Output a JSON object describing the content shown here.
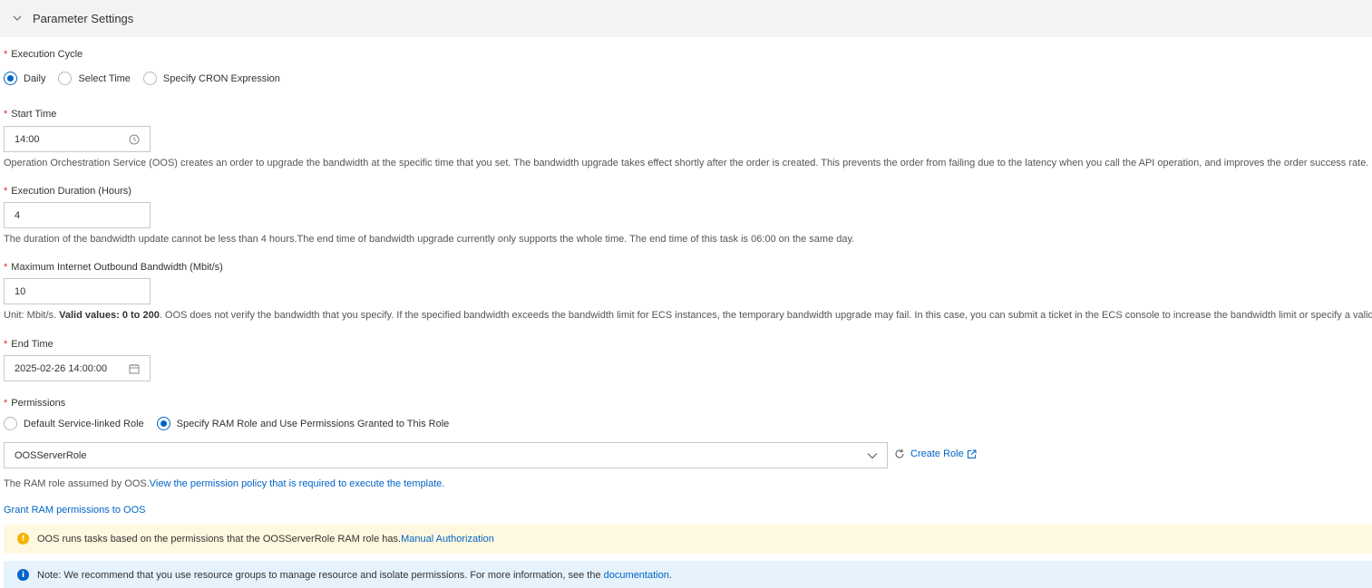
{
  "section": {
    "title": "Parameter Settings",
    "icon": "chevron-down-icon"
  },
  "required_mark": "*",
  "execution_cycle": {
    "label": "Execution Cycle",
    "options": [
      {
        "label": "Daily",
        "selected": true
      },
      {
        "label": "Select Time",
        "selected": false
      },
      {
        "label": "Specify CRON Expression",
        "selected": false
      }
    ]
  },
  "start_time": {
    "label": "Start Time",
    "value": "14:00",
    "icon": "clock-icon",
    "help": "Operation Orchestration Service (OOS) creates an order to upgrade the bandwidth at the specific time that you set. The bandwidth upgrade takes effect shortly after the order is created. This prevents the order from failing due to the latency when you call the API operation, and improves the order success rate."
  },
  "execution_duration": {
    "label": "Execution Duration (Hours)",
    "value": "4",
    "help": "The duration of the bandwidth update cannot be less than 4 hours.The end time of bandwidth upgrade currently only supports the whole time. The end time of this task is 06:00 on the same day."
  },
  "max_bandwidth": {
    "label": "Maximum Internet Outbound Bandwidth (Mbit/s)",
    "value": "10",
    "help_prefix": "Unit: Mbit/s.",
    "help_bold": "Valid values: 0 to 200",
    "help_suffix": ". OOS does not verify the bandwidth that you specify. If the specified bandwidth exceeds the bandwidth limit for ECS instances, the temporary bandwidth upgrade may fail. In this case, you can submit a ticket in the ECS console to increase the bandwidth limit or specify a valid value."
  },
  "end_time": {
    "label": "End Time",
    "value": "2025-02-26 14:00:00",
    "icon": "calendar-icon"
  },
  "permissions": {
    "label": "Permissions",
    "options": [
      {
        "label": "Default Service-linked Role",
        "selected": false
      },
      {
        "label": "Specify RAM Role and Use Permissions Granted to This Role",
        "selected": true
      }
    ],
    "role_value": "OOSServerRole",
    "create_role_label": "Create Role",
    "help_prefix": "The RAM role assumed by OOS.",
    "help_link": "View the permission policy that is required to execute the template.",
    "grant_link": "Grant RAM permissions to OOS"
  },
  "alerts": {
    "warning": {
      "text": "OOS runs tasks based on the permissions that the OOSServerRole RAM role has.",
      "link": "Manual Authorization",
      "icon": "warning-icon",
      "glyph": "!"
    },
    "info": {
      "text": "Note: We recommend that you use resource groups to manage resource and isolate permissions. For more information, see the ",
      "link": "documentation",
      "suffix": ".",
      "icon": "info-icon",
      "glyph": "i"
    }
  },
  "colors": {
    "accent": "#0064c8",
    "required": "#d93026",
    "warning_bg": "#fff8e0",
    "info_bg": "#e6f2fc",
    "header_bg": "#f2f3f5"
  }
}
